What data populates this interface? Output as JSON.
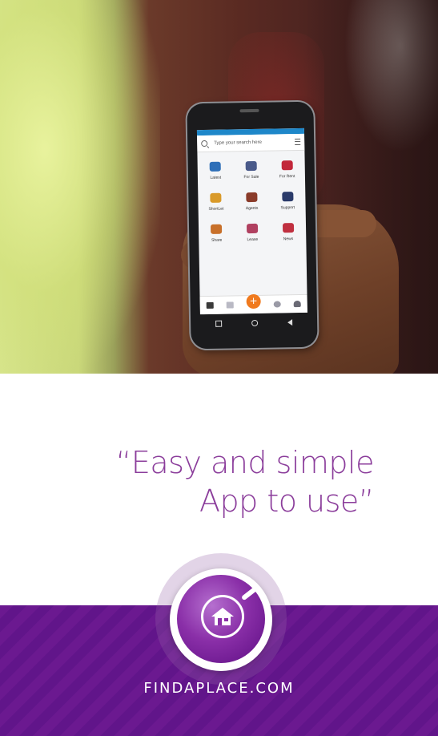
{
  "app_screen": {
    "search": {
      "placeholder": "Type your search here"
    },
    "tiles": [
      {
        "label": "Latest",
        "icon": "latest-icon",
        "color": "#2e6fb8"
      },
      {
        "label": "For Sale",
        "icon": "for-sale-icon",
        "color": "#4a5a8a"
      },
      {
        "label": "For Rent",
        "icon": "for-rent-icon",
        "color": "#c2273a"
      },
      {
        "label": "ShortLet",
        "icon": "shortlet-icon",
        "color": "#d99a2a"
      },
      {
        "label": "Agents",
        "icon": "agents-icon",
        "color": "#8a3b2a"
      },
      {
        "label": "Support",
        "icon": "support-icon",
        "color": "#2a3a6a"
      },
      {
        "label": "Share",
        "icon": "share-icon",
        "color": "#c8702a"
      },
      {
        "label": "Lease",
        "icon": "lease-icon",
        "color": "#b04060"
      },
      {
        "label": "News",
        "icon": "news-icon",
        "color": "#c03040"
      }
    ],
    "fab_label": "+"
  },
  "quote": {
    "line1": "“Easy and simple",
    "line2": "App to use”"
  },
  "footer": {
    "brand": "FINDAPLACE.COM"
  },
  "colors": {
    "accent": "#8b3d9b",
    "footer": "#6b1990",
    "fab": "#f07a1e"
  }
}
